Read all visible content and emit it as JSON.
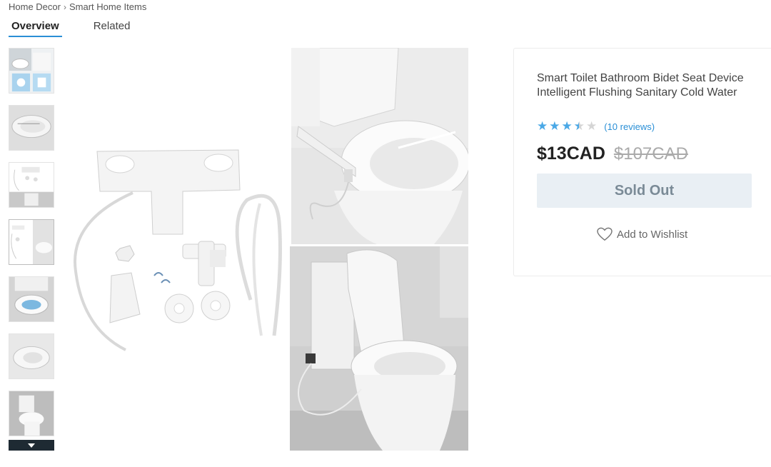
{
  "breadcrumb": {
    "items": [
      "Home Decor",
      "Smart Home Items"
    ],
    "separator": "›"
  },
  "tabs": [
    {
      "label": "Overview",
      "active": true
    },
    {
      "label": "Related",
      "active": false
    }
  ],
  "thumbnails": {
    "count": 7,
    "scroll_icon": "chevron-down-icon"
  },
  "product": {
    "title": "Smart Toilet Bathroom Bidet Seat Device Intelligent Flushing Sanitary Cold Water",
    "rating": 3.5,
    "rating_max": 5,
    "reviews_label": "(10 reviews)",
    "price": "$13CAD",
    "original_price": "$107CAD",
    "sold_out_label": "Sold Out",
    "wishlist_label": "Add to Wishlist",
    "wishlist_icon": "heart-icon"
  },
  "colors": {
    "accent": "#2a8fd6",
    "star": "#4aa8e6",
    "sold_out_bg": "#e9eff4",
    "sold_out_text": "#7a8a96"
  }
}
